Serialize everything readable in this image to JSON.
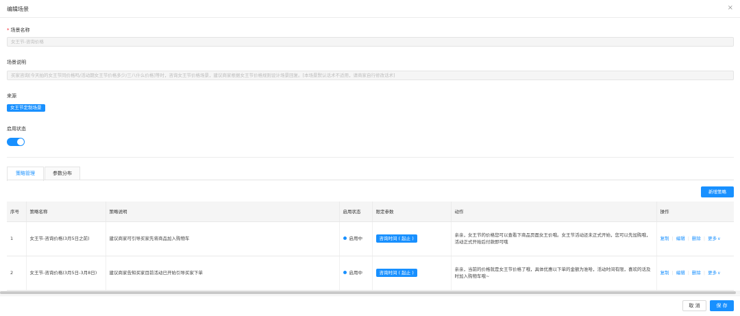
{
  "dialog": {
    "title": "编辑场景",
    "close_icon": "×"
  },
  "form": {
    "required_mark": "*",
    "scene_name_label": "场景名称",
    "scene_name_value": "女王节-咨询价格",
    "scene_desc_label": "场景说明",
    "scene_desc_value": "买家咨询[今天拍的女王节同价格吗/活动期女王节价格多少/三八什么价格]等时，咨询女王节价格场景，建议商家根据女王节价格规则设计场景回复。[本场景默认话术不适用，请商家自行修改话术]",
    "source_label": "来源",
    "source_tag": "女王节定制场景",
    "enable_label": "启用状态",
    "enabled": true
  },
  "tabs": [
    {
      "label": "策略管理",
      "active": true
    },
    {
      "label": "参数分布",
      "active": false
    }
  ],
  "toolbar": {
    "add_strategy": "新增策略"
  },
  "table": {
    "headers": [
      "序号",
      "策略名称",
      "策略说明",
      "启用状态",
      "限定参数",
      "动作",
      "操作"
    ],
    "rows": [
      {
        "index": "1",
        "name": "女王节-咨询价格(3月5日之前)",
        "desc": "建议商家可引导买家先将商品加入购物车",
        "status": "启用中",
        "param": "咨询时间 ( 起止 )",
        "action": "亲亲，女王节的价格您可以查看下商品页面女王价哦。女王节活动还未正式开始，您可以先加购哦，活动正式开始后付款即可哦",
        "ops": [
          "复制",
          "编辑",
          "删除",
          "更多"
        ]
      },
      {
        "index": "2",
        "name": "女王节-咨询价格(3月5日-3月8日)",
        "desc": "建议商家告知买家目前活动已开始引导买家下单",
        "status": "启用中",
        "param": "咨询时间 ( 起止 )",
        "action": "亲亲，当前的价格就是女王节价格了哦，具体优惠以下单的金额为准哈，活动时间有限，喜欢的话及时加入购物车哦~",
        "ops": [
          "复制",
          "编辑",
          "删除",
          "更多"
        ]
      }
    ]
  },
  "footer": {
    "cancel": "取 消",
    "save": "保 存"
  },
  "colors": {
    "primary": "#1890ff",
    "required": "#f5222d"
  }
}
